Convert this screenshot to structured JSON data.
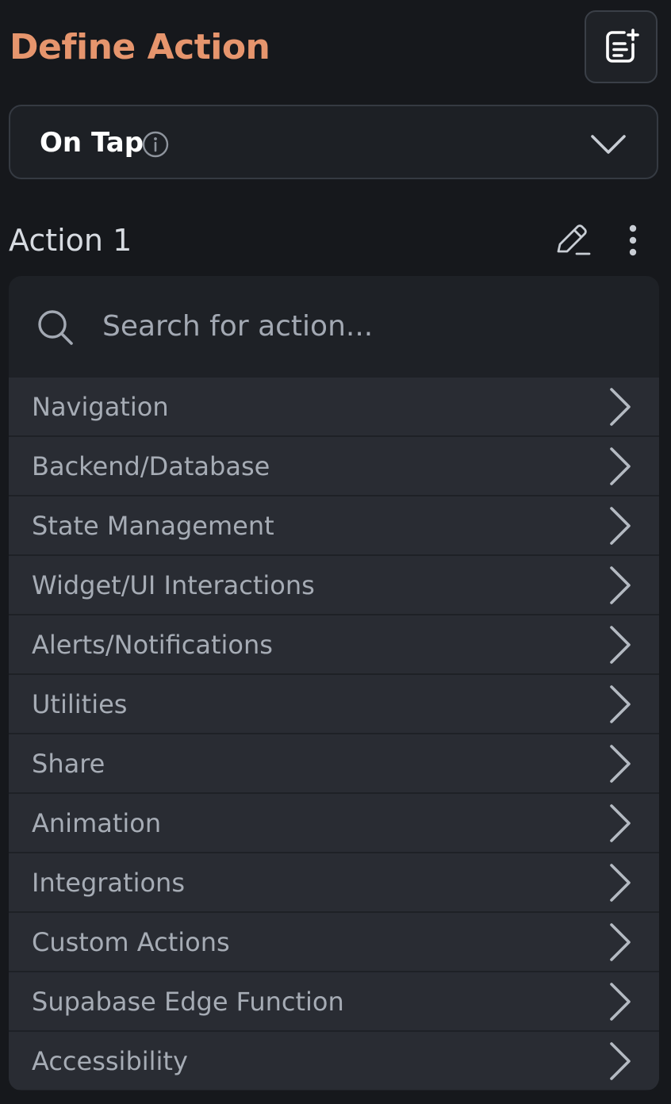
{
  "header": {
    "title": "Define Action",
    "notes_icon": "notes-add-icon"
  },
  "trigger": {
    "label": "On Tap",
    "info_icon": "info-icon",
    "dropdown_icon": "chevron-down-icon"
  },
  "action": {
    "label": "Action 1",
    "edit_icon": "pencil-icon",
    "more_icon": "more-vertical-icon"
  },
  "search": {
    "placeholder": "Search for action...",
    "icon": "search-icon"
  },
  "categories": [
    {
      "label": "Navigation"
    },
    {
      "label": "Backend/Database"
    },
    {
      "label": "State Management"
    },
    {
      "label": "Widget/UI Interactions"
    },
    {
      "label": "Alerts/Notifications"
    },
    {
      "label": "Utilities"
    },
    {
      "label": "Share"
    },
    {
      "label": "Animation"
    },
    {
      "label": "Integrations"
    },
    {
      "label": "Custom Actions"
    },
    {
      "label": "Supabase Edge Function"
    },
    {
      "label": "Accessibility"
    }
  ],
  "colors": {
    "background": "#16181c",
    "title_accent": "#e6956d",
    "panel": "#1e2126",
    "row": "#292c33",
    "row_text": "#a6acb5"
  }
}
